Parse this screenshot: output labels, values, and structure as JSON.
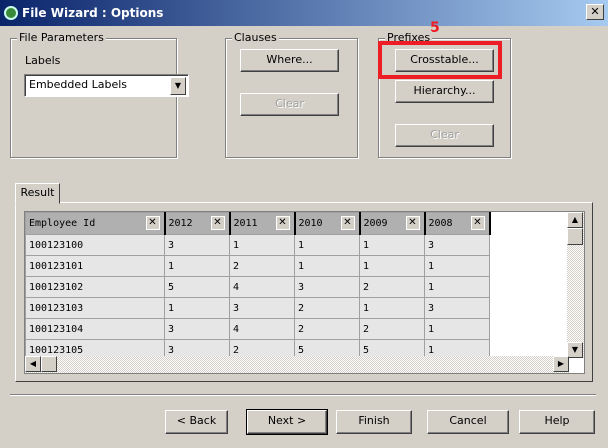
{
  "window": {
    "title": "File Wizard : Options",
    "close": "✕"
  },
  "annotation": {
    "label": "5",
    "color": "#ee1c24"
  },
  "file_parameters": {
    "title": "File Parameters",
    "labels_label": "Labels",
    "labels_value": "Embedded Labels"
  },
  "clauses": {
    "title": "Clauses",
    "where": "Where...",
    "clear": "Clear"
  },
  "prefixes": {
    "title": "Prefixes",
    "crosstable": "Crosstable...",
    "hierarchy": "Hierarchy...",
    "clear": "Clear"
  },
  "result": {
    "tab": "Result",
    "columns": [
      "Employee Id",
      "2012",
      "2011",
      "2010",
      "2009",
      "2008"
    ],
    "rows": [
      [
        "100123100",
        "3",
        "1",
        "1",
        "1",
        "3"
      ],
      [
        "100123101",
        "1",
        "2",
        "1",
        "1",
        "1"
      ],
      [
        "100123102",
        "5",
        "4",
        "3",
        "2",
        "1"
      ],
      [
        "100123103",
        "1",
        "3",
        "2",
        "1",
        "3"
      ],
      [
        "100123104",
        "3",
        "4",
        "2",
        "2",
        "1"
      ],
      [
        "100123105",
        "3",
        "2",
        "5",
        "5",
        "1"
      ]
    ]
  },
  "footer": {
    "back": "< Back",
    "next": "Next >",
    "finish": "Finish",
    "cancel": "Cancel",
    "help": "Help"
  }
}
